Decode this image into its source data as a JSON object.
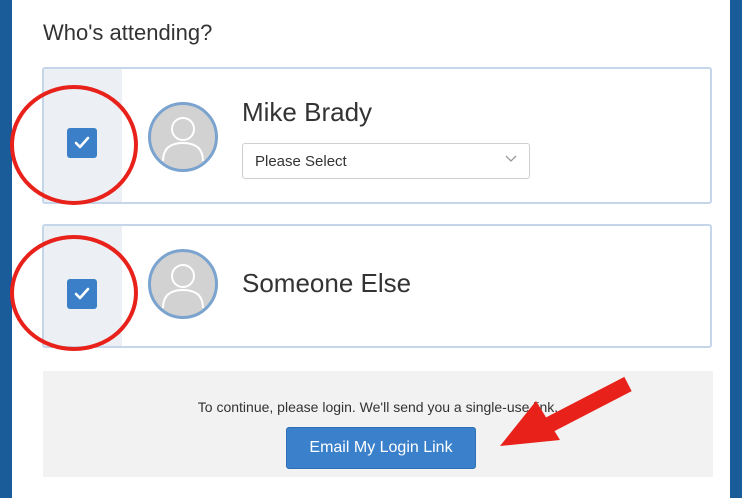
{
  "attendance": {
    "heading": "Who's attending?",
    "attendees": [
      {
        "name": "Mike Brady",
        "checked": true,
        "select_value": "Please Select"
      },
      {
        "name": "Someone Else",
        "checked": true
      }
    ]
  },
  "login": {
    "message": "To continue, please login. We'll send you a single-use link.",
    "button_label": "Email My Login Link"
  },
  "colors": {
    "page_frame": "#1a5b9a",
    "accent": "#3b7fc9",
    "annotation": "#e8221b"
  }
}
